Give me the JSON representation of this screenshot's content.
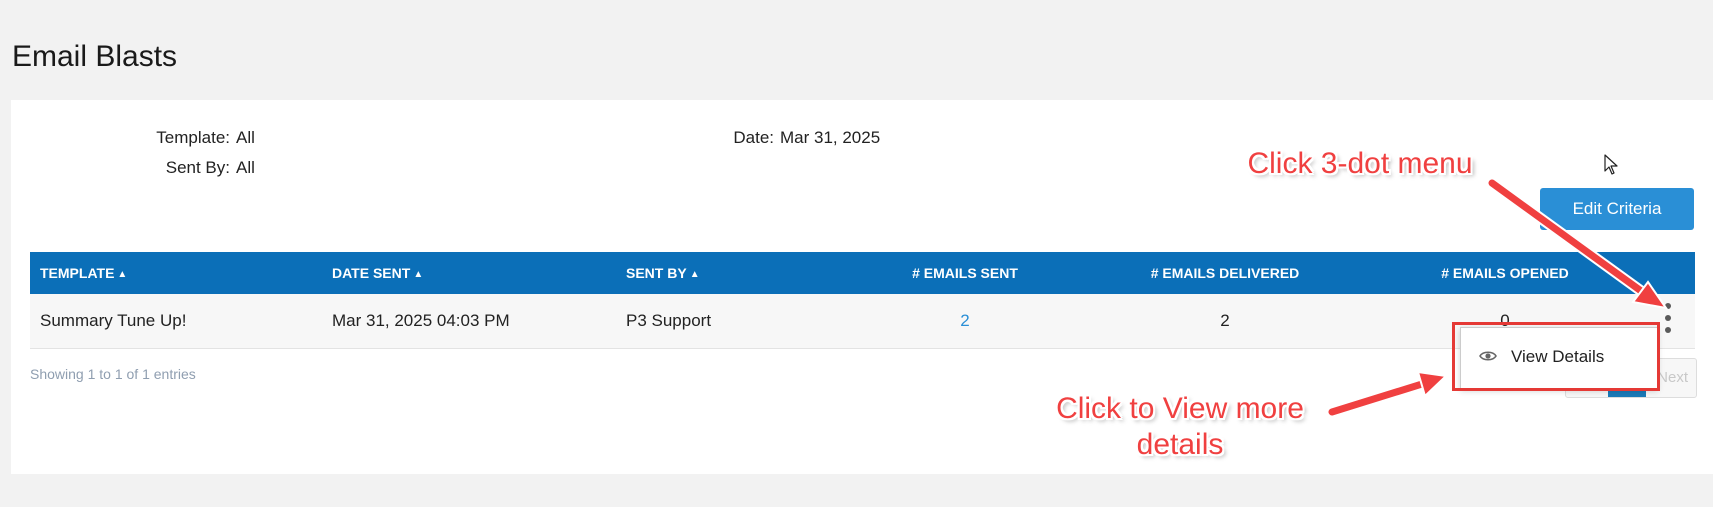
{
  "page": {
    "title": "Email Blasts"
  },
  "criteria": {
    "template_label": "Template:",
    "template_value": "All",
    "sent_by_label": "Sent By:",
    "sent_by_value": "All",
    "date_label": "Date:",
    "date_value": "Mar 31, 2025"
  },
  "buttons": {
    "edit_criteria": "Edit Criteria"
  },
  "table": {
    "columns": [
      "TEMPLATE",
      "DATE SENT",
      "SENT BY",
      "# EMAILS SENT",
      "# EMAILS DELIVERED",
      "# EMAILS OPENED"
    ],
    "sortable": [
      true,
      true,
      true,
      false,
      false,
      false
    ],
    "rows": [
      {
        "template": "Summary Tune Up!",
        "date_sent": "Mar 31, 2025 04:03 PM",
        "sent_by": "P3 Support",
        "emails_sent": "2",
        "emails_delivered": "2",
        "emails_opened": "0"
      }
    ]
  },
  "footer": {
    "showing": "Showing 1 to 1 of 1 entries",
    "next": "Next"
  },
  "row_menu": {
    "items": [
      {
        "label": "View Details",
        "icon": "eye-icon"
      }
    ]
  },
  "annotations": {
    "click_menu": "Click 3-dot menu",
    "click_view_line1": "Click to View more",
    "click_view_line2": "details"
  },
  "colors": {
    "header_bg": "#0b6fb8",
    "button_bg": "#2a8fd6",
    "link": "#2a8fd6",
    "annotation": "#f04040"
  },
  "icons": {
    "sort": "sort-icon",
    "kebab": "kebab-menu-icon",
    "view": "eye-icon",
    "cursor": "mouse-cursor-icon"
  }
}
